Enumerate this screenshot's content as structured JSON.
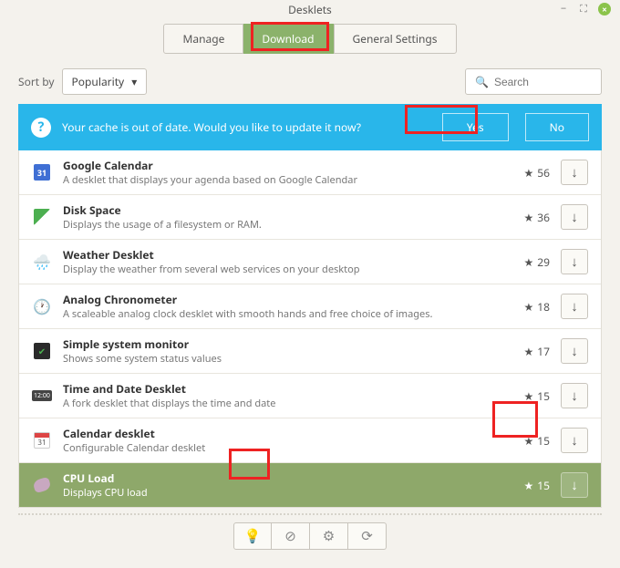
{
  "window": {
    "title": "Desklets"
  },
  "tabs": {
    "manage": "Manage",
    "download": "Download",
    "general": "General Settings"
  },
  "sort": {
    "label": "Sort by",
    "value": "Popularity"
  },
  "search": {
    "placeholder": "Search"
  },
  "banner": {
    "text": "Your cache is out of date. Would you like to update it now?",
    "yes": "Yes",
    "no": "No"
  },
  "items": [
    {
      "title": "Google Calendar",
      "desc": "A desklet that displays your agenda based on Google Calendar",
      "rating": "56",
      "cal": "31"
    },
    {
      "title": "Disk Space",
      "desc": "Displays the usage of a filesystem or RAM.",
      "rating": "36"
    },
    {
      "title": "Weather Desklet",
      "desc": "Display the weather from several web services on your desktop",
      "rating": "29"
    },
    {
      "title": "Analog Chronometer",
      "desc": "A scaleable analog clock desklet with smooth hands and free choice of images.",
      "rating": "18"
    },
    {
      "title": "Simple system monitor",
      "desc": "Shows some system status values",
      "rating": "17"
    },
    {
      "title": "Time and Date Desklet",
      "desc": "A fork desklet that displays the time and date",
      "rating": "15",
      "time": "12:00"
    },
    {
      "title": "Calendar desklet",
      "desc": "Configurable Calendar desklet",
      "rating": "15",
      "cal2": "31"
    },
    {
      "title": "CPU Load",
      "desc": "Displays CPU load",
      "rating": "15"
    }
  ]
}
